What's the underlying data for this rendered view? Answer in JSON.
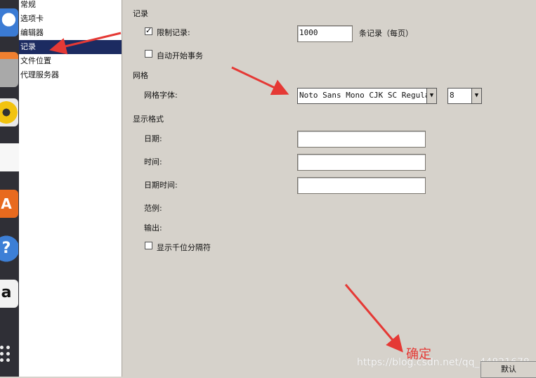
{
  "sidebar": {
    "items": [
      {
        "label": "常规"
      },
      {
        "label": "选项卡"
      },
      {
        "label": "编辑器"
      },
      {
        "label": "记录"
      },
      {
        "label": "文件位置"
      },
      {
        "label": "代理服务器"
      }
    ],
    "selected": "记录"
  },
  "records_section": {
    "title": "记录",
    "limit_checkbox_label": "限制记录:",
    "limit_checked": true,
    "limit_value": "1000",
    "limit_suffix": "条记录（每页）",
    "auto_transaction_label": "自动开始事务",
    "auto_transaction_checked": false
  },
  "grid_section": {
    "title": "网格",
    "font_label": "网格字体:",
    "font_value": "Noto Sans Mono CJK SC Regular",
    "size_value": "8"
  },
  "format_section": {
    "title": "显示格式",
    "date_label": "日期:",
    "time_label": "时间:",
    "datetime_label": "日期时间:",
    "date_value": "",
    "time_value": "",
    "datetime_value": "",
    "example_label": "范例:",
    "output_label": "输出:",
    "thousands_label": "显示千位分隔符",
    "thousands_checked": false
  },
  "footer": {
    "default_button": "默认"
  },
  "annotation": {
    "confirm_text": "确定",
    "watermark": "https://blog.csdn.net/qq_44821678",
    "arrow_color": "#e53935"
  },
  "dock": {
    "icons": [
      "thunderbird-icon",
      "files-icon",
      "rhythmbox-icon",
      "writer-icon",
      "software-center-icon",
      "help-icon",
      "amazon-icon",
      "apps-grid-icon"
    ]
  }
}
